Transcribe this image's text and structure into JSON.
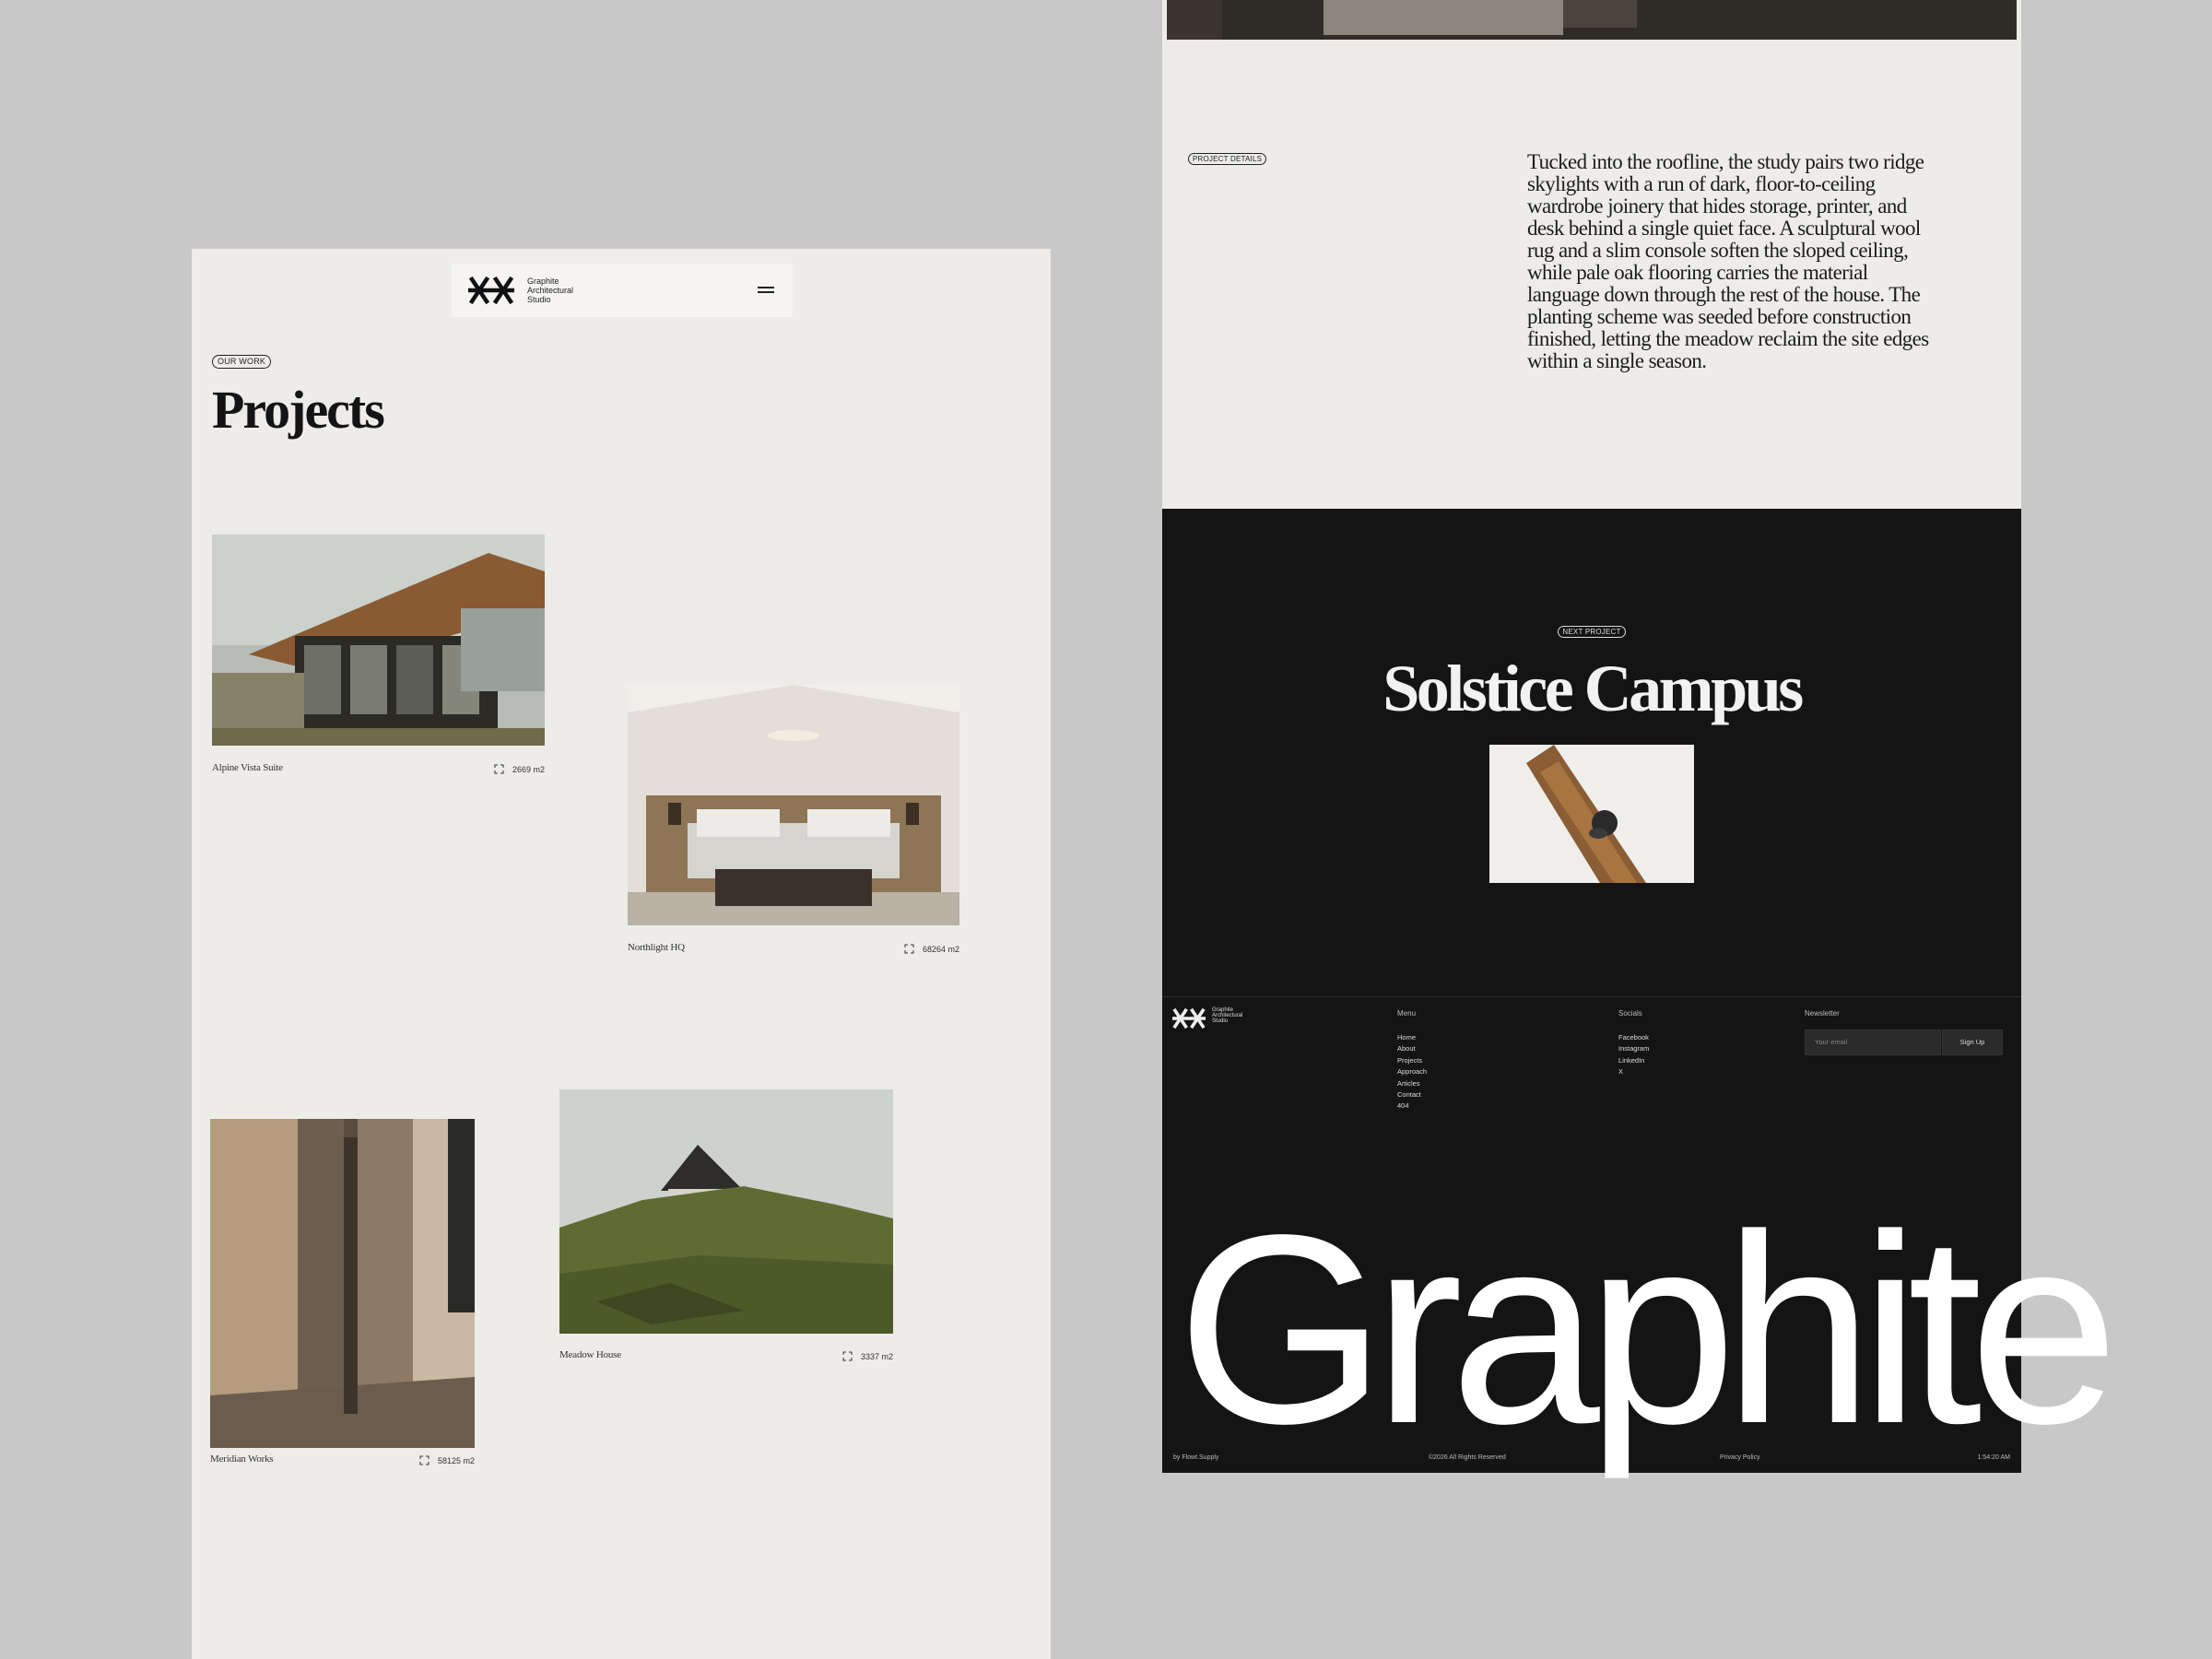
{
  "brand": {
    "name_lines": [
      "Graphite",
      "Architectural",
      "Studio"
    ]
  },
  "nav": {
    "menu_icon": "hamburger-icon"
  },
  "projects_page": {
    "eyebrow": "OUR WORK",
    "title": "Projects",
    "cards": [
      {
        "name": "Alpine Vista Suite",
        "area": "2669 m2"
      },
      {
        "name": "Northlight HQ",
        "area": "68264 m2"
      },
      {
        "name": "Meridian Works",
        "area": "58125 m2"
      },
      {
        "name": "Meadow House",
        "area": "3337 m2"
      }
    ]
  },
  "details_page": {
    "eyebrow": "PROJECT DETAILS",
    "description": "Tucked into the roofline, the study pairs two ridge skylights with a run of dark, floor-to-ceiling wardrobe joinery that hides storage, printer, and desk behind a single quiet face. A sculptural wool rug and a slim console soften the sloped ceiling, while pale oak flooring carries the material language down through the rest of the house. The planting scheme was seeded before construction finished, letting the meadow reclaim the site edges within a single season."
  },
  "next_project": {
    "eyebrow": "NEXT PROJECT",
    "title": "Solstice Campus"
  },
  "footer": {
    "menu_heading": "Menu",
    "menu_items": [
      "Home",
      "About",
      "Projects",
      "Approach",
      "Articles",
      "Contact",
      "404"
    ],
    "socials_heading": "Socials",
    "social_items": [
      "Facebook",
      "Instagram",
      "LinkedIn",
      "X"
    ],
    "newsletter_heading": "Newsletter",
    "newsletter_placeholder": "Your email",
    "newsletter_button": "Sign Up",
    "big_word": "Graphite",
    "credit": "by Flowt.Supply",
    "copyright": "©2026 All Rights Reserved",
    "privacy": "Privacy Policy",
    "clock": "1:54:20 AM"
  },
  "colors": {
    "page_bg": "#c8c8c8",
    "panel_light": "#eeece8",
    "panel_dark": "#141414"
  }
}
